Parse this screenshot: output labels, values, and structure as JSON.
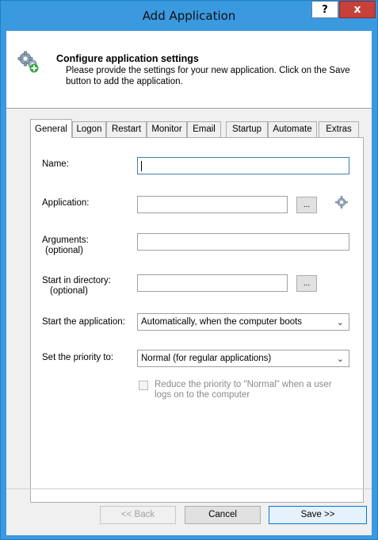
{
  "window": {
    "title": "Add Application",
    "help_label": "?",
    "close_label": "x"
  },
  "header": {
    "title": "Configure application settings",
    "description": "Please provide the settings for your new application. Click on the Save button to add the application."
  },
  "tabs": [
    {
      "label": "General",
      "active": true
    },
    {
      "label": "Logon",
      "active": false
    },
    {
      "label": "Restart",
      "active": false
    },
    {
      "label": "Monitor",
      "active": false
    },
    {
      "label": "Email",
      "active": false
    },
    {
      "label": "Startup",
      "active": false
    },
    {
      "label": "Automate",
      "active": false
    },
    {
      "label": "Extras",
      "active": false
    }
  ],
  "form": {
    "name": {
      "label": "Name:",
      "value": ""
    },
    "application": {
      "label": "Application:",
      "value": "",
      "browse_label": "..."
    },
    "arguments": {
      "label": "Arguments:",
      "sublabel": "(optional)",
      "value": ""
    },
    "start_dir": {
      "label": "Start in directory:",
      "sublabel": "(optional)",
      "value": "",
      "browse_label": "..."
    },
    "start_app": {
      "label": "Start the application:",
      "selected": "Automatically, when the computer boots"
    },
    "priority": {
      "label": "Set the priority to:",
      "selected": "Normal (for regular applications)"
    },
    "reduce_priority": {
      "line1": "Reduce the priority to \"Normal\" when a user",
      "line2": "logs on to the computer",
      "checked": false
    }
  },
  "buttons": {
    "back": "<< Back",
    "cancel": "Cancel",
    "save": "Save >>"
  }
}
